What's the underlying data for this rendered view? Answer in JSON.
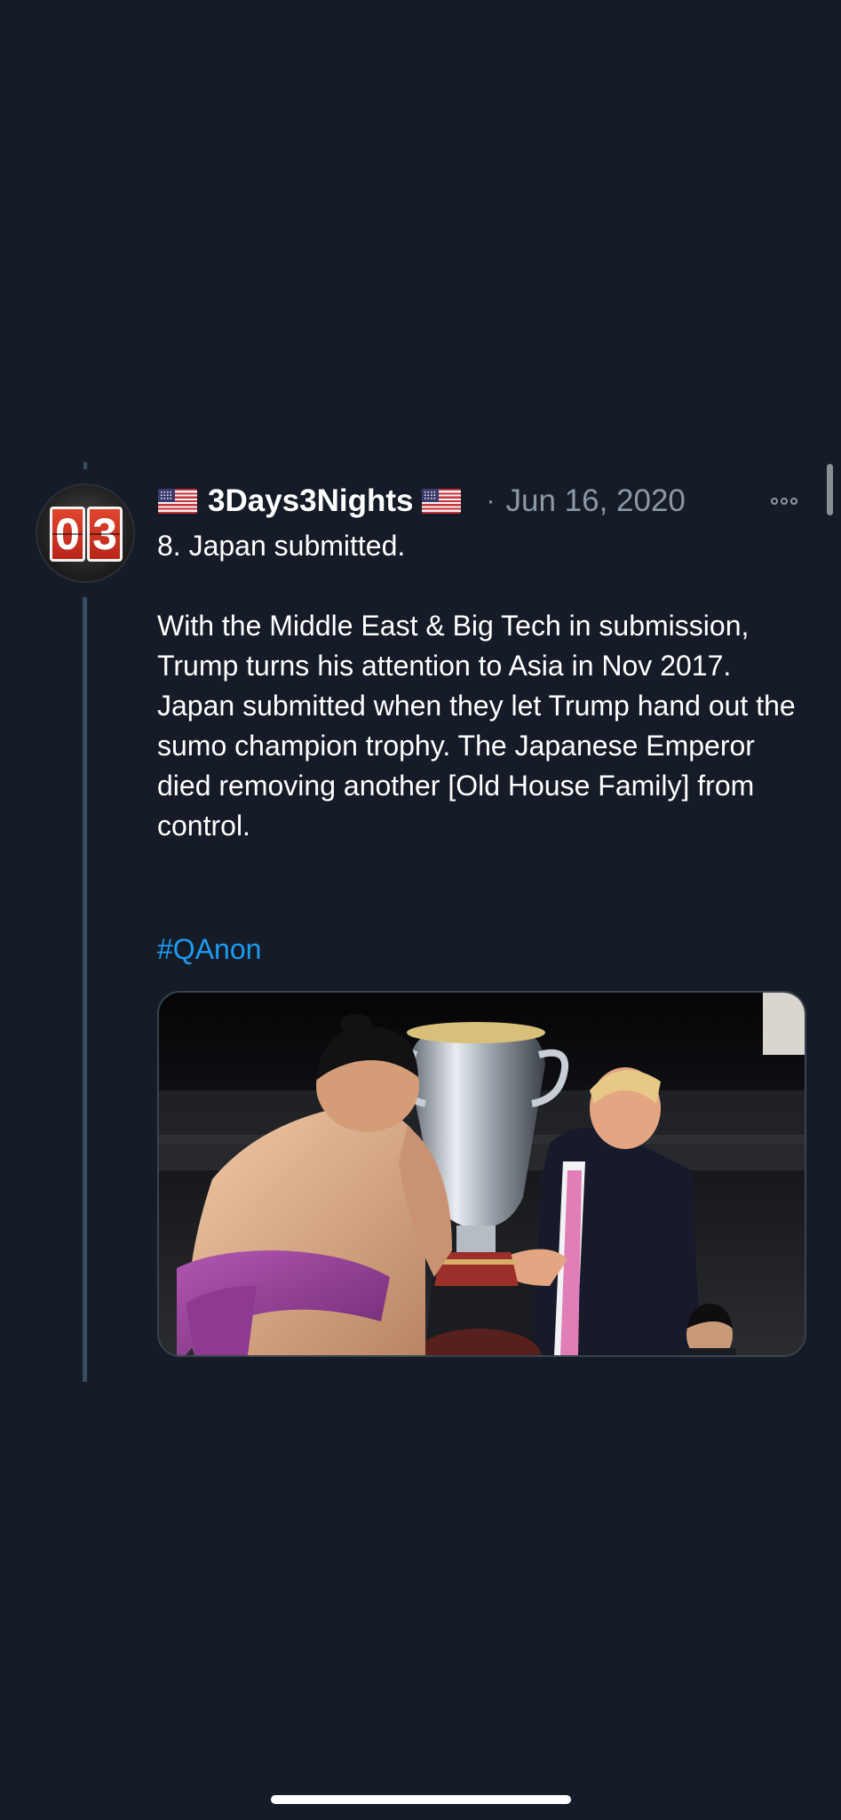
{
  "tweet": {
    "avatar_text": [
      "0",
      "3"
    ],
    "author": "3Days3Nights",
    "separator": "·",
    "date": "Jun 16, 2020",
    "body": "8. Japan submitted.\n\nWith the Middle East & Big Tech in submission, Trump turns his attention to Asia in Nov 2017. Japan submitted when they let Trump hand out the sumo champion trophy. The Japanese Emperor died removing another [Old House Family] from control.",
    "hashtag": "#QAnon",
    "media_icon": "photo-sumo-trophy",
    "more_icon": "more-options-icon"
  },
  "colors": {
    "background": "#151c28",
    "text": "#ffffff",
    "secondary": "#8b98a5",
    "link": "#1d9bf0",
    "thread_line": "#3a4d60"
  }
}
